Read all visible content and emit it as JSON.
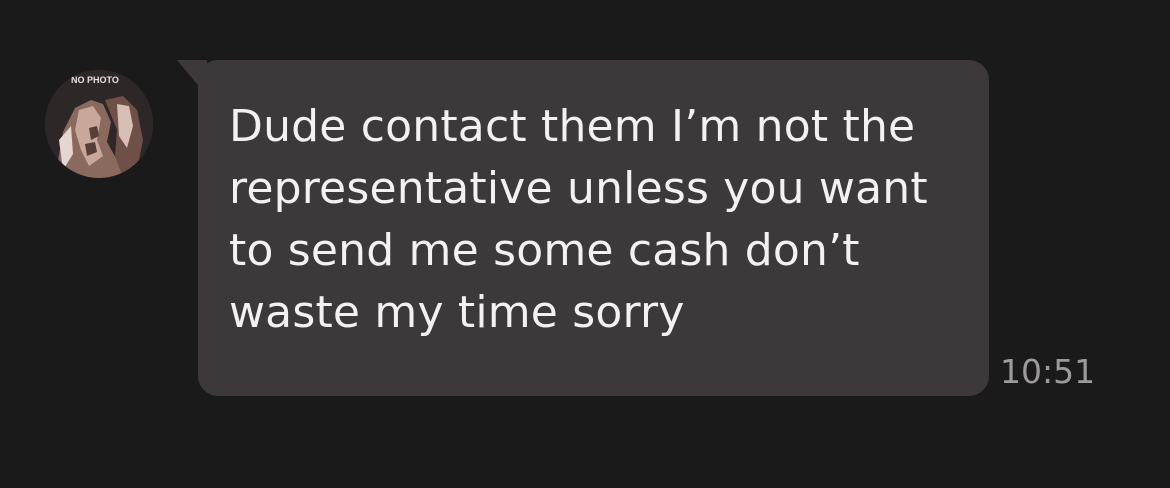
{
  "conversation": {
    "avatar": {
      "label": "NO PHOTO",
      "icon": "profile-photo-placeholder"
    },
    "message": {
      "text": "Dude contact them I’m not the\nrepresentative unless you want\nto send me some cash don’t\nwaste my time sorry",
      "time": "10:51"
    }
  },
  "colors": {
    "background": "#1b1a1b",
    "bubble": "#3d3839",
    "message_text": "#f3f1f1",
    "timestamp": "#9d9a9b"
  }
}
